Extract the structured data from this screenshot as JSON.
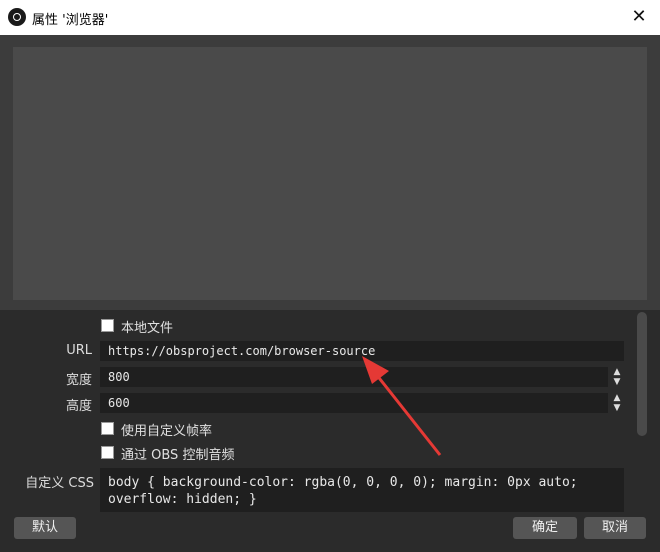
{
  "window": {
    "title": "属性 '浏览器'"
  },
  "form": {
    "local_file_label": "本地文件",
    "url_label": "URL",
    "url_value": "https://obsproject.com/browser-source",
    "width_label": "宽度",
    "width_value": "800",
    "height_label": "高度",
    "height_value": "600",
    "custom_fps_label": "使用自定义帧率",
    "control_audio_label": "通过 OBS 控制音频",
    "custom_css_label": "自定义 CSS",
    "custom_css_value": "body { background-color: rgba(0, 0, 0, 0); margin: 0px auto; overflow: hidden; }"
  },
  "buttons": {
    "defaults": "默认",
    "ok": "确定",
    "cancel": "取消"
  },
  "icons": {
    "app": "obs-logo-icon",
    "close": "close-icon",
    "spin": "spin-arrows-icon",
    "annotation": "red-arrow-icon"
  },
  "colors": {
    "background": "#2b2b2b",
    "field": "#1f1f1f",
    "annotation_arrow": "#e53935"
  }
}
